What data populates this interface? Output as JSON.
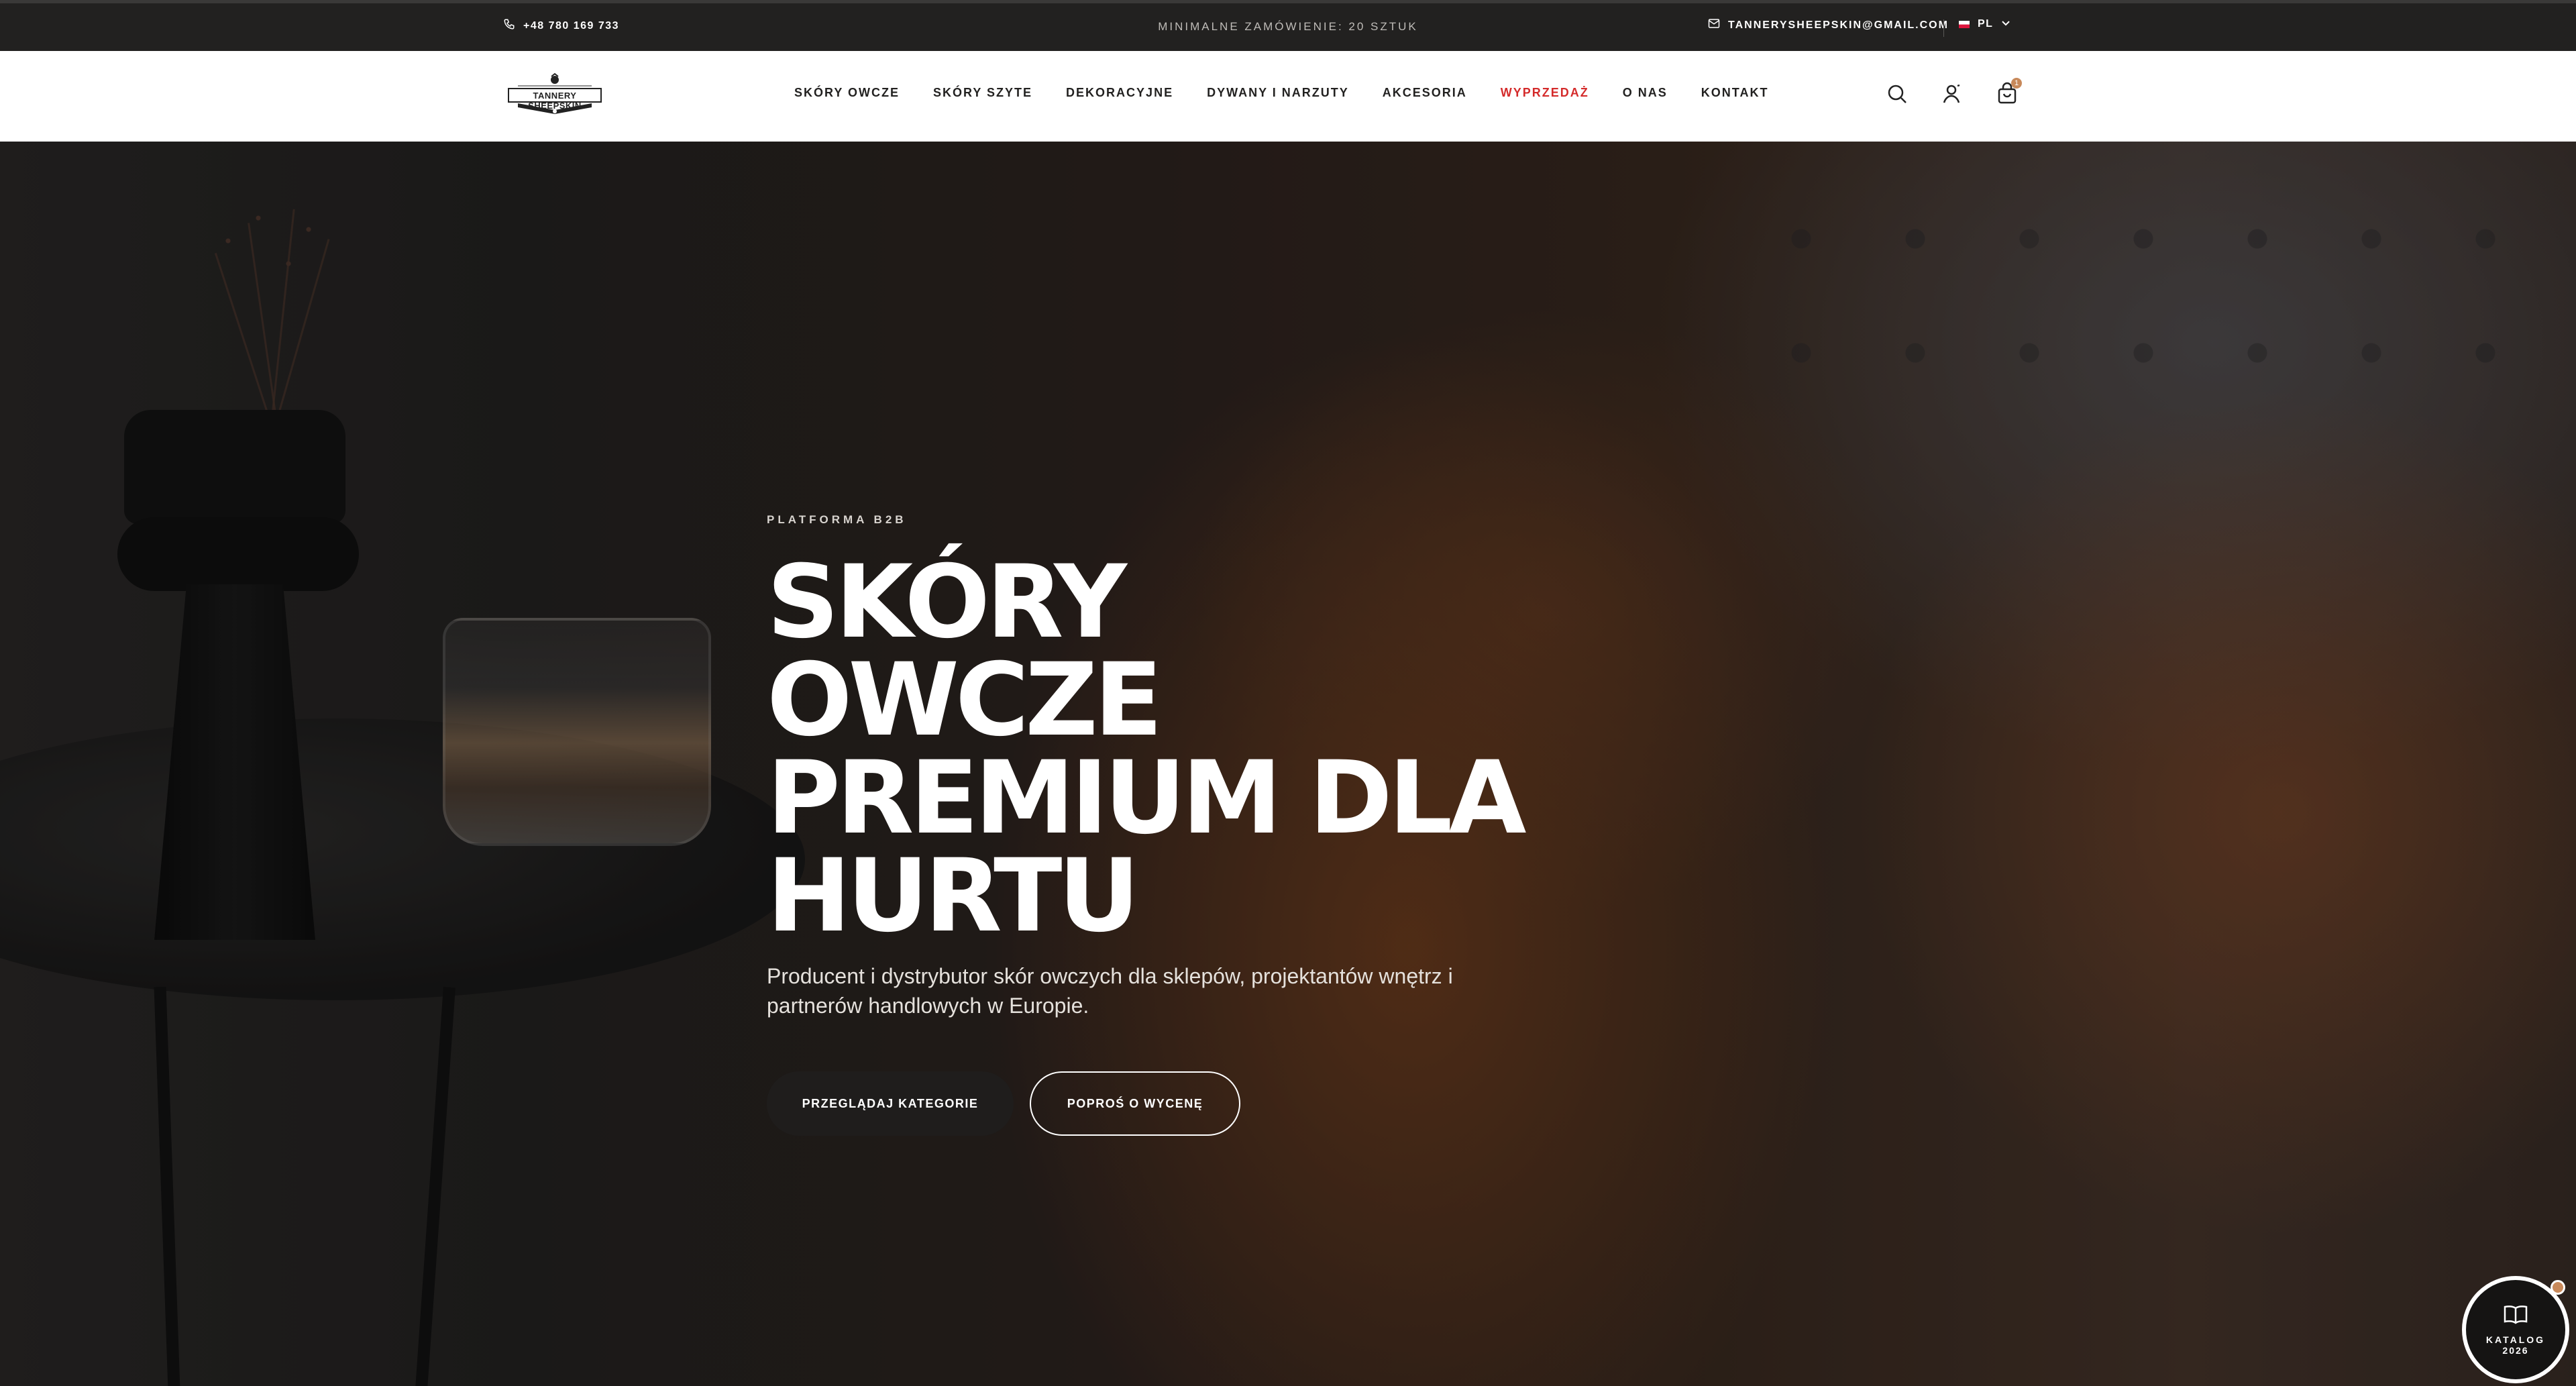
{
  "topbar": {
    "phone": "+48 780 169 733",
    "notice": "MINIMALNE ZAMÓWIENIE: 20 SZTUK",
    "email": "TANNERYSHEEPSKIN@GMAIL.COM",
    "language": "PL"
  },
  "header": {
    "logo_text": "TANNERY SHEEPSKIN",
    "nav": [
      {
        "label": "SKÓRY OWCZE"
      },
      {
        "label": "SKÓRY SZYTE"
      },
      {
        "label": "DEKORACYJNE"
      },
      {
        "label": "DYWANY I NARZUTY"
      },
      {
        "label": "AKCESORIA"
      },
      {
        "label": "WYPRZEDAŻ"
      },
      {
        "label": "O NAS"
      },
      {
        "label": "KONTAKT"
      }
    ],
    "icons": [
      "search-icon",
      "user-icon",
      "cart-icon"
    ],
    "cart_count": "1"
  },
  "hero": {
    "eyebrow": "PLATFORMA B2B",
    "title": "SKÓRY OWCZE PREMIUM DLA HURTU",
    "subtitle": "Producent i dystrybutor skór owczych dla sklepów, projektantów wnętrz i partnerów handlowych w Europie.",
    "primary_button": "PRZEGLĄDAJ KATEGORIE",
    "secondary_button": "POPROŚ O WYCENĘ"
  },
  "catalog": {
    "label": "KATALOG",
    "year": "2026"
  },
  "colors": {
    "topbar_bg": "#222120",
    "sale_red": "#d42b2b",
    "accent": "#c8895a"
  }
}
